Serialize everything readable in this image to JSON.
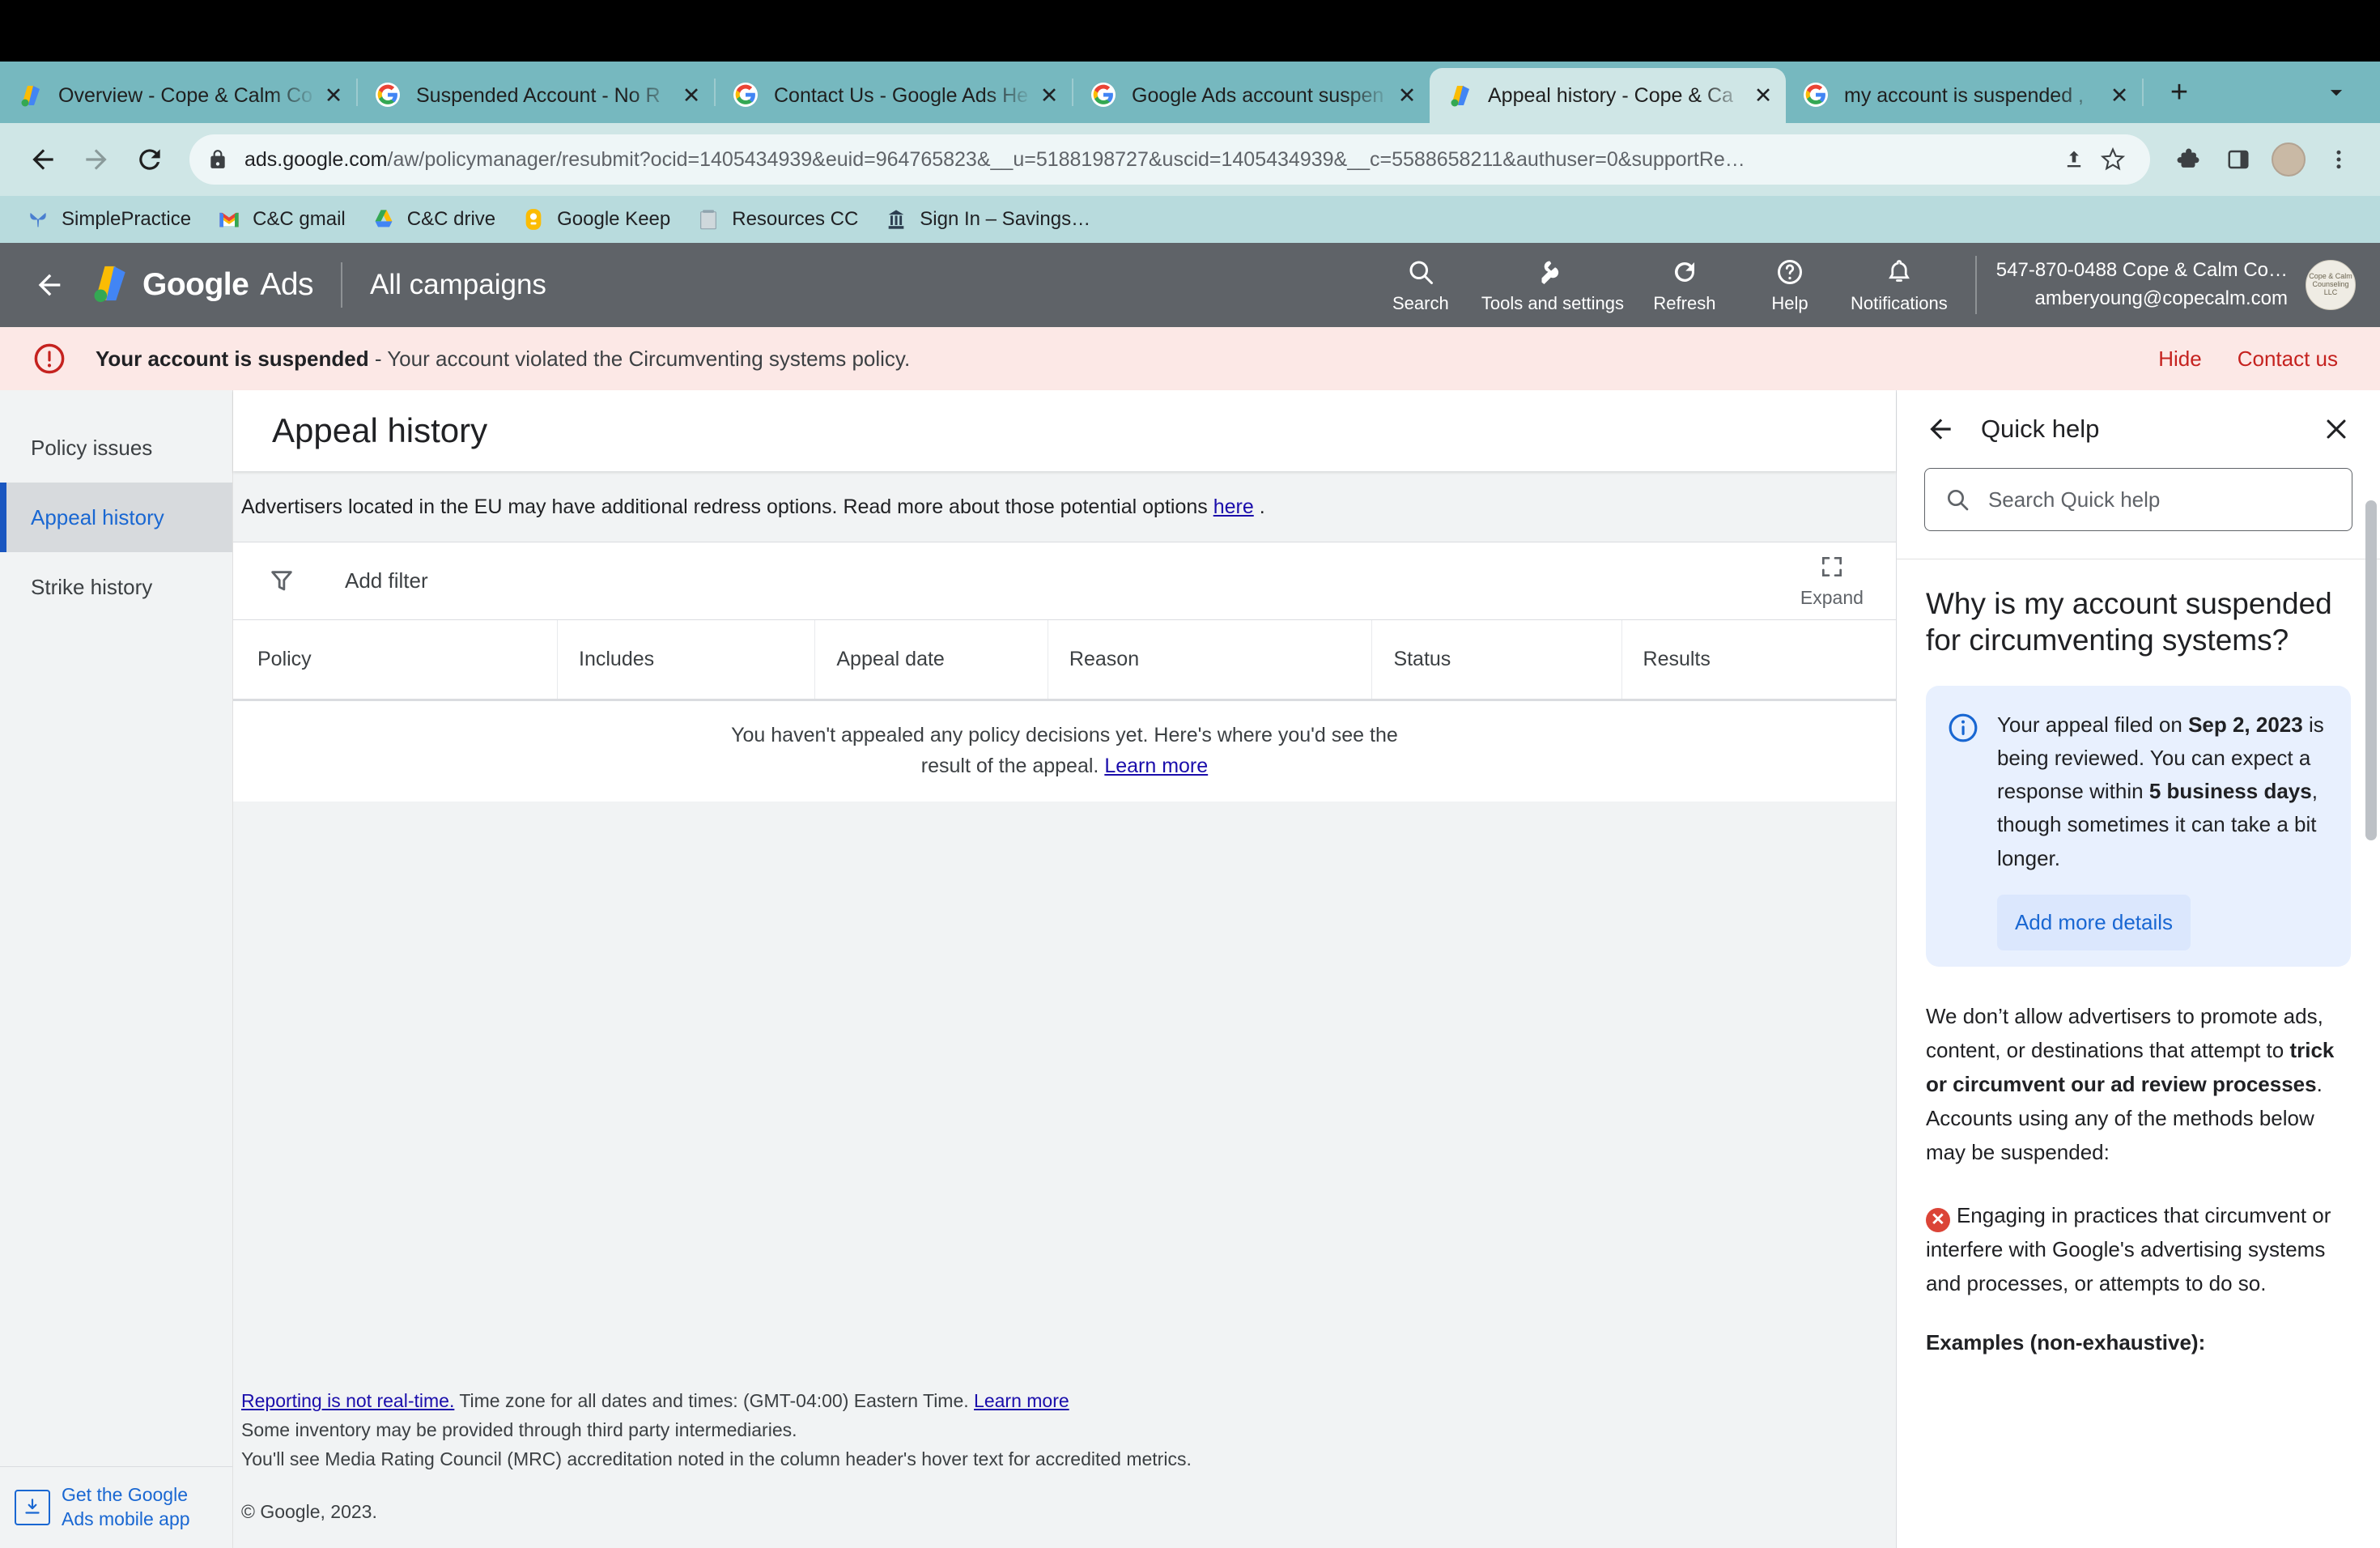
{
  "browser": {
    "tabs": [
      {
        "title": "Overview - Cope & Calm Co",
        "favicon": "google-ads-icon",
        "active": false
      },
      {
        "title": "Suspended Account - No R",
        "favicon": "google-g-icon",
        "active": false
      },
      {
        "title": "Contact Us - Google Ads He",
        "favicon": "google-g-icon",
        "active": false
      },
      {
        "title": "Google Ads account suspen",
        "favicon": "google-g-icon",
        "active": false
      },
      {
        "title": "Appeal history - Cope & Ca",
        "favicon": "google-ads-icon",
        "active": true
      },
      {
        "title": "my account is suspended ,",
        "favicon": "google-g-icon",
        "active": false
      }
    ],
    "new_tab_label": "+",
    "url_domain": "ads.google.com",
    "url_path": "/aw/policymanager/resubmit?ocid=1405434939&euid=964765823&__u=5188198727&uscid=1405434939&__c=5588658211&authuser=0&supportRe…",
    "bookmarks": [
      {
        "label": "SimplePractice",
        "icon": "butterfly-icon"
      },
      {
        "label": "C&C gmail",
        "icon": "gmail-icon"
      },
      {
        "label": "C&C drive",
        "icon": "google-drive-icon"
      },
      {
        "label": "Google Keep",
        "icon": "google-keep-icon"
      },
      {
        "label": "Resources CC",
        "icon": "folder-icon"
      },
      {
        "label": "Sign In – Savings…",
        "icon": "bank-icon"
      }
    ]
  },
  "ads_header": {
    "logo_word_1": "Google",
    "logo_word_2": "Ads",
    "campaigns_label": "All campaigns",
    "actions": [
      {
        "label": "Search",
        "icon": "search-icon"
      },
      {
        "label": "Tools and settings",
        "icon": "wrench-icon"
      },
      {
        "label": "Refresh",
        "icon": "refresh-icon"
      },
      {
        "label": "Help",
        "icon": "help-icon"
      },
      {
        "label": "Notifications",
        "icon": "bell-icon"
      }
    ],
    "account_name": "547-870-0488 Cope & Calm Co…",
    "account_email": "amberyoung@copecalm.com",
    "avatar_text": "Cope & Calm Counseling LLC"
  },
  "suspension_banner": {
    "title": "Your account is suspended",
    "detail": " - Your account violated the Circumventing systems policy.",
    "hide_label": "Hide",
    "contact_label": "Contact us",
    "accent_color": "#c5221f",
    "background_color": "#fce8e6"
  },
  "leftnav": {
    "items": [
      {
        "label": "Policy issues",
        "selected": false
      },
      {
        "label": "Appeal history",
        "selected": true
      },
      {
        "label": "Strike history",
        "selected": false
      }
    ],
    "mobile_promo_line1": "Get the Google",
    "mobile_promo_line2": "Ads mobile app",
    "accent_color": "#1967d2"
  },
  "main": {
    "page_title": "Appeal history",
    "eu_notice_text": "Advertisers located in the EU may have additional redress options. Read more about those potential options ",
    "eu_notice_link": "here",
    "eu_notice_suffix": " .",
    "filter_label": "Add filter",
    "expand_label": "Expand",
    "table": {
      "columns": [
        "Policy",
        "Includes",
        "Appeal date",
        "Reason",
        "Status",
        "Results"
      ],
      "rows": [],
      "empty_line1": "You haven't appealed any policy decisions yet. Here's where you'd see the",
      "empty_line2": "result of the appeal.",
      "empty_link": "Learn more"
    },
    "footer": {
      "link1": "Reporting is not real-time.",
      "line1_rest": " Time zone for all dates and times: (GMT-04:00) Eastern Time. ",
      "link2": "Learn more",
      "line2": "Some inventory may be provided through third party intermediaries.",
      "line3": "You'll see Media Rating Council (MRC) accreditation noted in the column header's hover text for accredited metrics.",
      "copyright": "© Google, 2023."
    }
  },
  "quick_help": {
    "title": "Quick help",
    "search_placeholder": "Search Quick help",
    "search_value": "",
    "heading": "Why is my account suspended for circumventing systems?",
    "info_box": {
      "text_1": "Your appeal filed on ",
      "bold_1": "Sep 2, 2023",
      "text_2": " is being reviewed. You can expect a response within ",
      "bold_2": "5 business days",
      "text_3": ", though sometimes it can take a bit longer.",
      "button_label": "Add more details",
      "background_color": "#e8f0fe"
    },
    "para_1_a": "We don’t allow advertisers to promote ads, content, or destinations that attempt to ",
    "para_1_bold": "trick or circumvent our ad review processes",
    "para_1_b": ". Accounts using any of the methods below may be suspended:",
    "bullet_1": "Engaging in practices that circumvent or interfere with Google's advertising systems and processes, or attempts to do so.",
    "examples_heading": "Examples (non-exhaustive):"
  }
}
